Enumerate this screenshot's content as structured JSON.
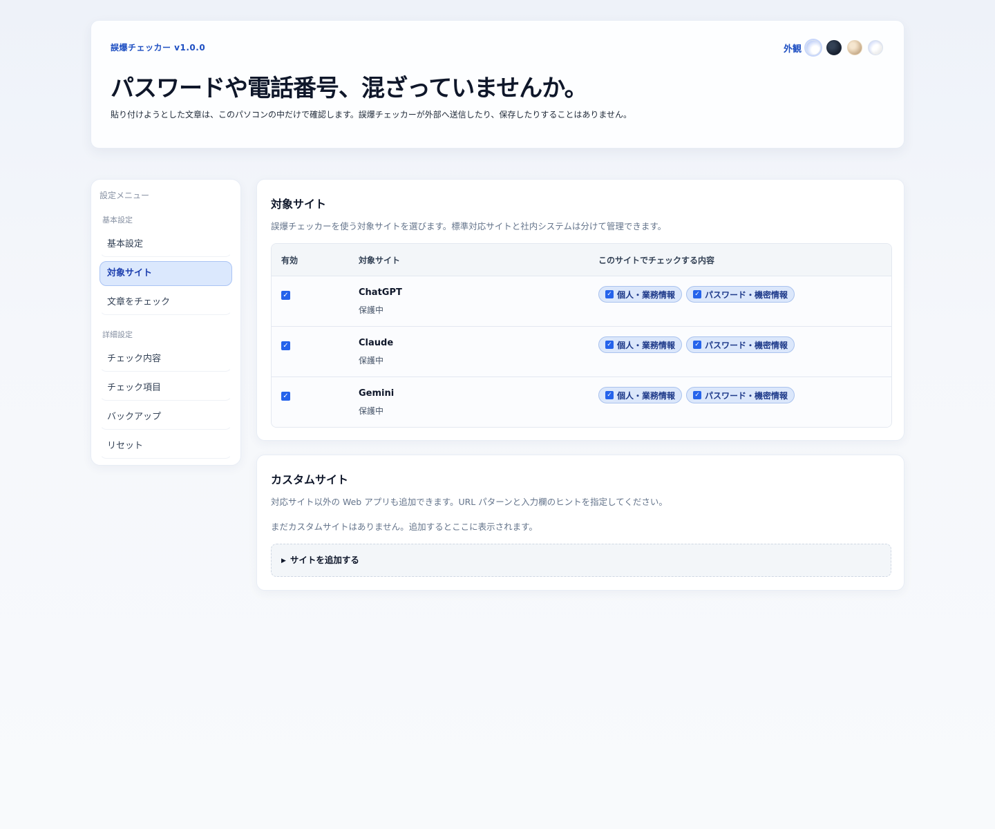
{
  "header": {
    "brand": "誤爆チェッカー v1.0.0",
    "theme_label": "外観",
    "themes": [
      "light",
      "dark",
      "sepia",
      "white"
    ],
    "title": "パスワードや電話番号、混ざっていませんか。",
    "subtitle": "貼り付けようとした文章は、このパソコンの中だけで確認します。誤爆チェッカーが外部へ送信したり、保存したりすることはありません。"
  },
  "sidebar": {
    "title": "設定メニュー",
    "groups": [
      {
        "label": "基本設定",
        "items": [
          {
            "label": "基本設定",
            "active": false
          },
          {
            "label": "対象サイト",
            "active": true
          },
          {
            "label": "文章をチェック",
            "active": false
          }
        ]
      },
      {
        "label": "詳細設定",
        "items": [
          {
            "label": "チェック内容",
            "active": false
          },
          {
            "label": "チェック項目",
            "active": false
          },
          {
            "label": "バックアップ",
            "active": false
          },
          {
            "label": "リセット",
            "active": false
          }
        ]
      }
    ]
  },
  "sites_section": {
    "title": "対象サイト",
    "description": "誤爆チェッカーを使う対象サイトを選びます。標準対応サイトと社内システムは分けて管理できます。",
    "columns": [
      "有効",
      "対象サイト",
      "このサイトでチェックする内容"
    ],
    "rows": [
      {
        "enabled": true,
        "name": "ChatGPT",
        "status": "保護中",
        "checks": [
          "個人・業務情報",
          "パスワード・機密情報"
        ]
      },
      {
        "enabled": true,
        "name": "Claude",
        "status": "保護中",
        "checks": [
          "個人・業務情報",
          "パスワード・機密情報"
        ]
      },
      {
        "enabled": true,
        "name": "Gemini",
        "status": "保護中",
        "checks": [
          "個人・業務情報",
          "パスワード・機密情報"
        ]
      }
    ]
  },
  "custom_section": {
    "title": "カスタムサイト",
    "description": "対応サイト以外の Web アプリも追加できます。URL パターンと入力欄のヒントを指定してください。",
    "empty_message": "まだカスタムサイトはありません。追加するとここに表示されます。",
    "add_label": "サイトを追加する"
  },
  "colors": {
    "accent": "#2563eb",
    "brand": "#1e4fc2",
    "active_bg": "#dbe8fd"
  }
}
